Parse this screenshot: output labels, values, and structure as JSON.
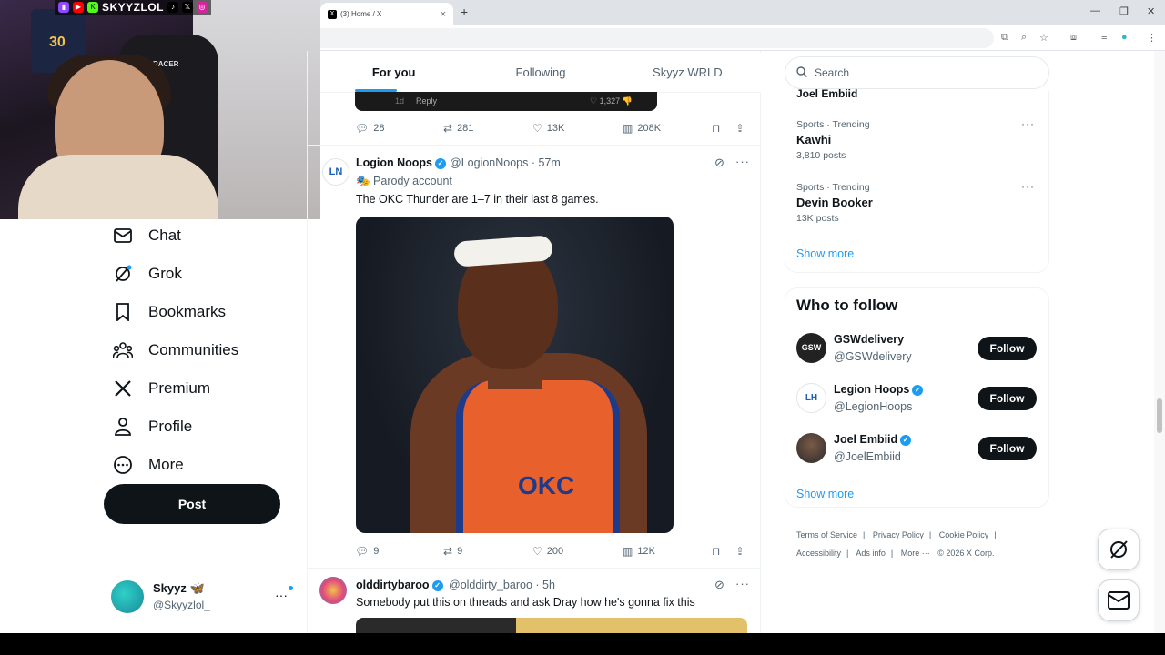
{
  "browser": {
    "tab_title": "(3) Home / X",
    "tab_close": "×",
    "new_tab": "+",
    "minimize": "—",
    "restore": "❐",
    "close": "✕"
  },
  "stream": {
    "handle": "SKYYZLOL",
    "chair_brand": "RACER",
    "jersey_number": "30"
  },
  "nav": {
    "items": [
      {
        "label": "Chat",
        "icon": "mail-icon"
      },
      {
        "label": "Grok",
        "icon": "grok-icon"
      },
      {
        "label": "Bookmarks",
        "icon": "bookmark-icon"
      },
      {
        "label": "Communities",
        "icon": "communities-icon"
      },
      {
        "label": "Premium",
        "icon": "x-logo-icon"
      },
      {
        "label": "Profile",
        "icon": "person-icon"
      },
      {
        "label": "More",
        "icon": "more-circle-icon"
      }
    ],
    "post_label": "Post"
  },
  "account": {
    "name": "Skyyz 🦋",
    "handle": "@Skyyzlol_",
    "more": "···"
  },
  "feed_tabs": [
    "For you",
    "Following",
    "Skyyz WRLD"
  ],
  "embedded": {
    "time": "1d",
    "reply": "Reply",
    "likes": "1,327"
  },
  "tweet0_stats": {
    "replies": "28",
    "reposts": "281",
    "likes": "13K",
    "views": "208K"
  },
  "tweet1": {
    "name": "Logion Noops",
    "handle": "@LogionNoops",
    "time": "57m",
    "label": "Parody account",
    "text": "The OKC Thunder are 1–7 in their last 8 games.",
    "jersey_text": "OKC",
    "stats": {
      "replies": "9",
      "reposts": "9",
      "likes": "200",
      "views": "12K"
    }
  },
  "tweet2": {
    "name": "olddirtybaroo",
    "handle": "@olddirty_baroo",
    "time": "5h",
    "text": "Somebody put this on threads and ask Dray how he's gonna fix this"
  },
  "search": {
    "placeholder": "Search"
  },
  "trends": {
    "clipped_top": "Joel Embiid",
    "items": [
      {
        "category": "Sports · Trending",
        "title": "Kawhi",
        "count": "3,810 posts"
      },
      {
        "category": "Sports · Trending",
        "title": "Devin Booker",
        "count": "13K posts"
      }
    ],
    "show_more": "Show more"
  },
  "who_to_follow": {
    "title": "Who to follow",
    "items": [
      {
        "name": "GSWdelivery",
        "handle": "@GSWdelivery",
        "verified": false,
        "button": "Follow"
      },
      {
        "name": "Legion Hoops",
        "handle": "@LegionHoops",
        "verified": true,
        "button": "Follow"
      },
      {
        "name": "Joel Embiid",
        "handle": "@JoelEmbiid",
        "verified": true,
        "button": "Follow"
      }
    ],
    "show_more": "Show more"
  },
  "footer": {
    "line1": [
      "Terms of Service",
      "Privacy Policy",
      "Cookie Policy"
    ],
    "line2": [
      "Accessibility",
      "Ads info",
      "More ···",
      "© 2026 X Corp."
    ]
  },
  "colors": {
    "accent": "#1d9bf0",
    "text": "#0f1419",
    "muted": "#536471"
  }
}
